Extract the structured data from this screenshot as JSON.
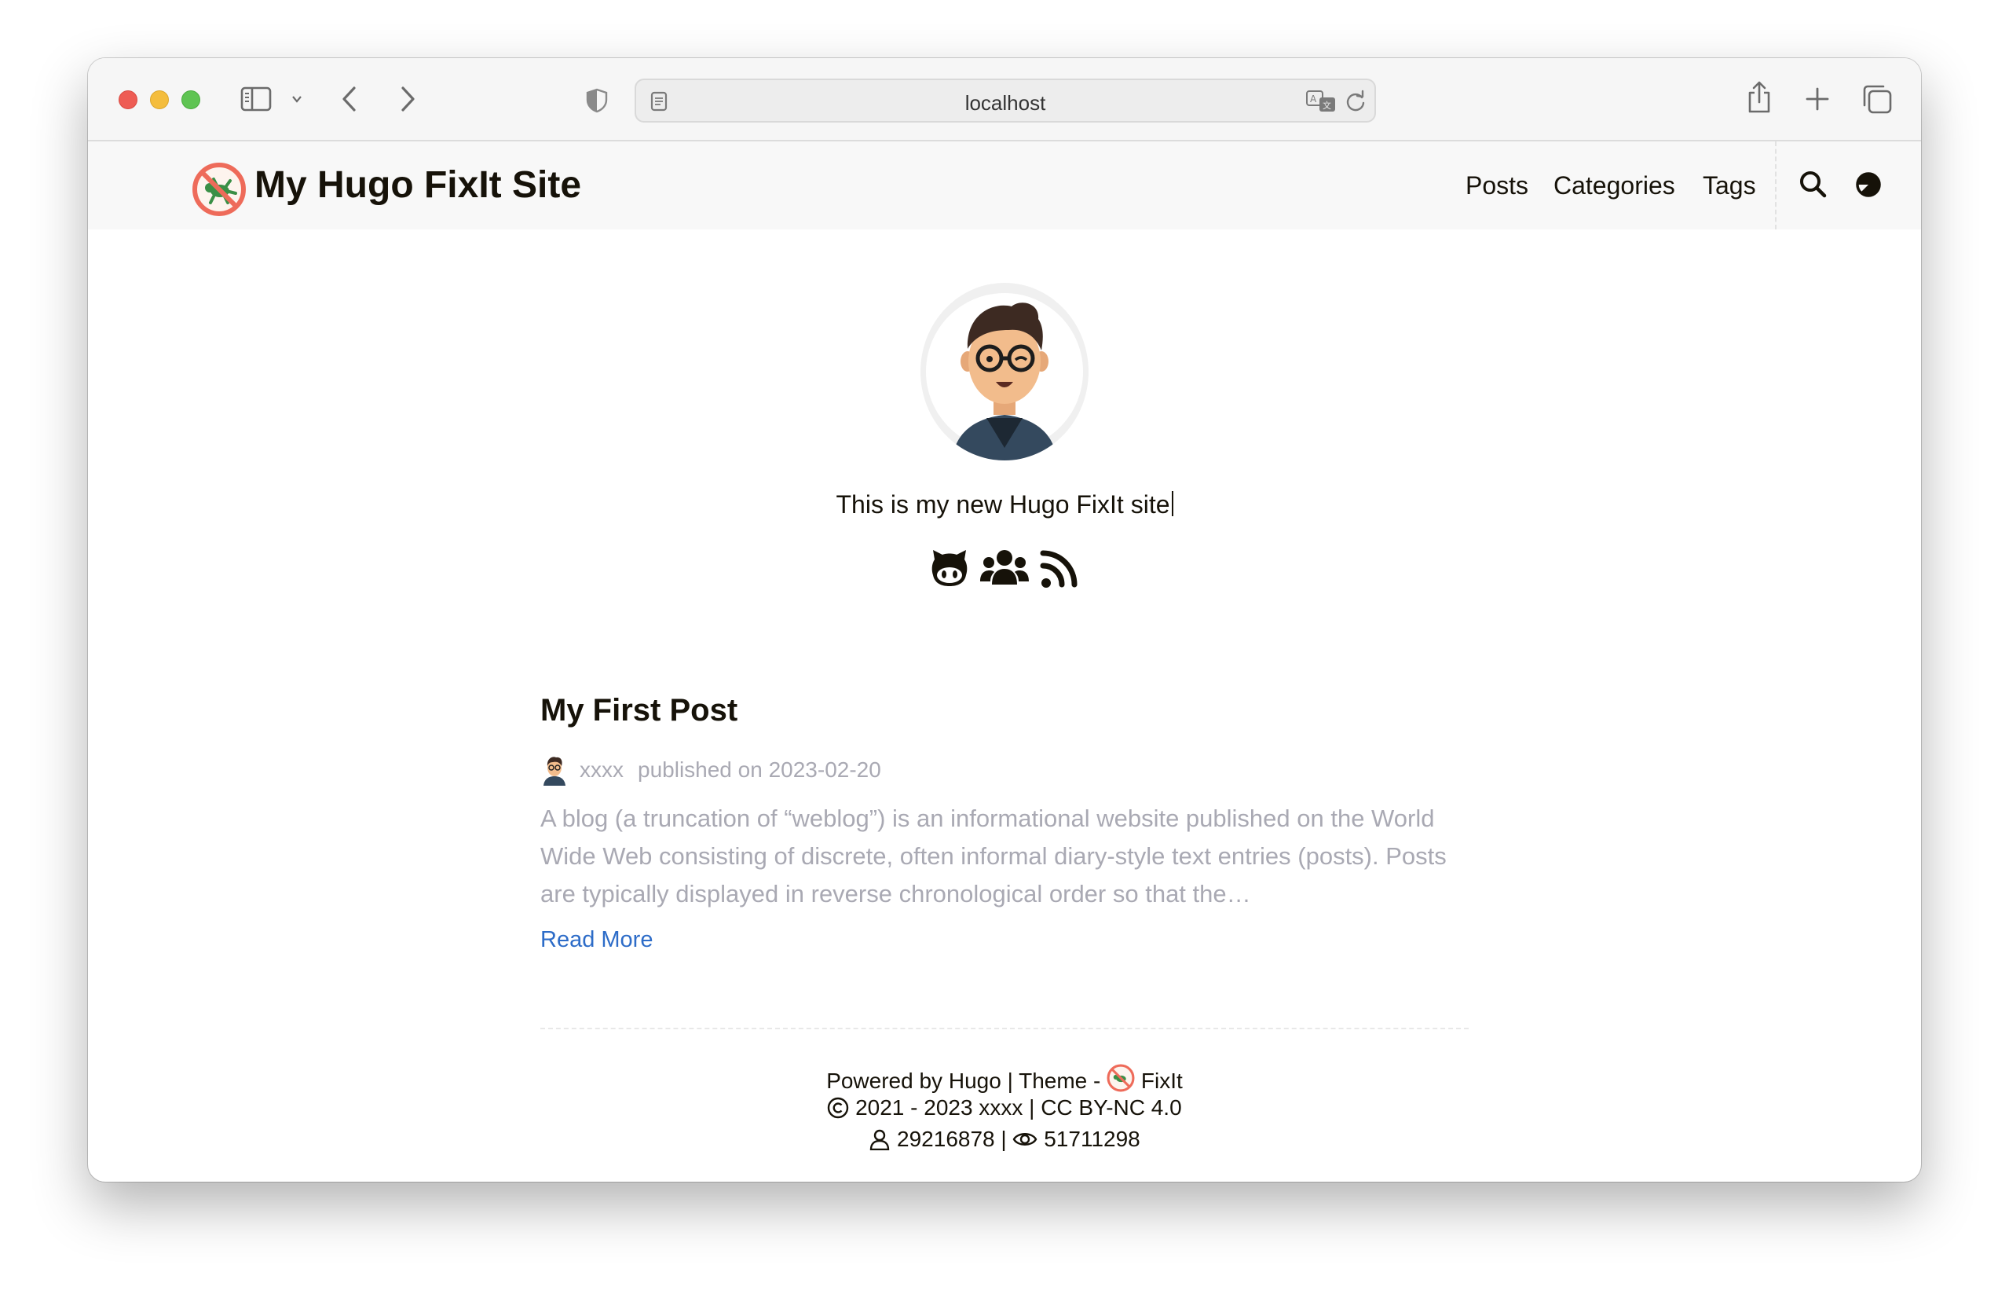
{
  "browser": {
    "url": "localhost"
  },
  "site": {
    "title": "My Hugo FixIt Site",
    "nav": [
      "Posts",
      "Categories",
      "Tags"
    ]
  },
  "home": {
    "subtitle": "This is my new Hugo FixIt site",
    "social_icons": [
      "github-icon",
      "users-icon",
      "rss-icon"
    ]
  },
  "post": {
    "title": "My First Post",
    "author": "xxxx",
    "published": "published on 2023-02-20",
    "summary": "A blog (a truncation of “weblog”) is an informational website published on the World Wide Web consisting of discrete, often informal diary-style text entries (posts). Posts are typically displayed in reverse chronological order so that the…",
    "read_more": "Read More"
  },
  "footer": {
    "powered_prefix": "Powered by",
    "hugo": "Hugo",
    "theme_sep": "| Theme -",
    "theme": "FixIt",
    "copyright_years": "2021 - 2023",
    "copyright_author": "xxxx",
    "license_sep": "|",
    "license": "CC BY-NC 4.0",
    "visitors": "29216878",
    "views_sep": "|",
    "views": "51711298"
  },
  "colors": {
    "accent_link": "#2d6cc8",
    "muted_text": "#a9a9b3",
    "logo_ring": "#ee6b5a"
  }
}
